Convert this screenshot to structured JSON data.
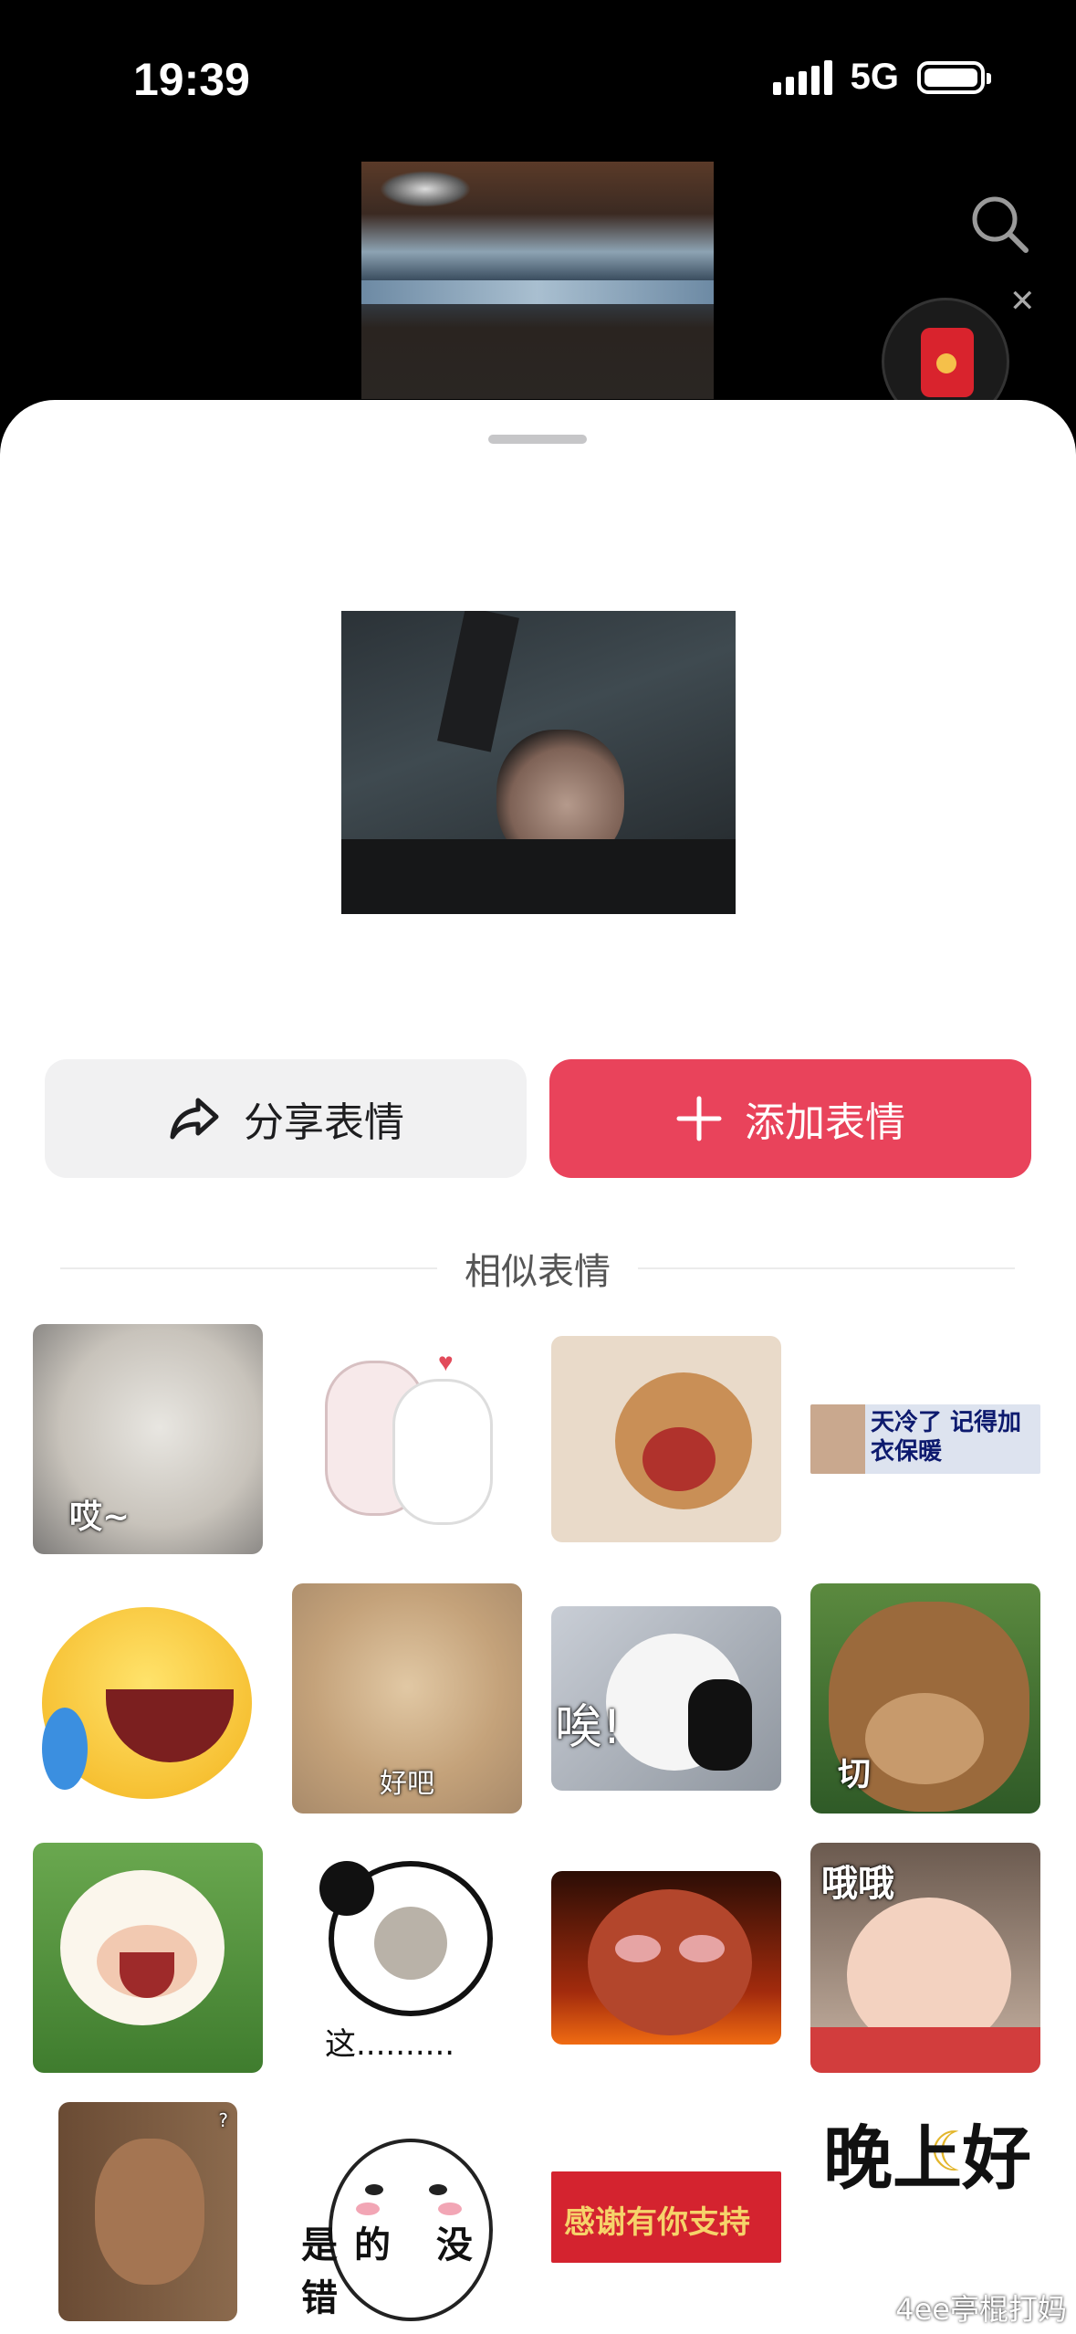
{
  "status_bar": {
    "time": "19:39",
    "network": "5G"
  },
  "sheet": {
    "share_label": "分享表情",
    "add_label": "添加表情",
    "section_title": "相似表情"
  },
  "stickers": [
    {
      "name": "cat-grey",
      "caption": "哎~"
    },
    {
      "name": "bunny-hug",
      "caption": ""
    },
    {
      "name": "jerry-laugh",
      "caption": ""
    },
    {
      "name": "cold-weather",
      "caption": "天冷了 记得加衣保暖"
    },
    {
      "name": "emoji-crying-laugh",
      "caption": ""
    },
    {
      "name": "cat-sad",
      "caption": "好吧"
    },
    {
      "name": "panda-sigh",
      "caption": "唉!"
    },
    {
      "name": "bear-briar",
      "caption": "切"
    },
    {
      "name": "lamb-cry",
      "caption": ""
    },
    {
      "name": "panda-meme",
      "caption": "这.........."
    },
    {
      "name": "pepe-angry",
      "caption": ""
    },
    {
      "name": "baby-oh",
      "caption": "哦哦"
    },
    {
      "name": "bear-question",
      "caption": "?"
    },
    {
      "name": "blob-ok",
      "caption": "是的 没错"
    },
    {
      "name": "thanks-support",
      "caption": "感谢有你支持"
    },
    {
      "name": "good-evening",
      "caption": "晚上好"
    }
  ],
  "watermark": "4ee亭棍打妈",
  "colors": {
    "accent": "#e9435b",
    "share_bg": "#f1f1f2"
  }
}
